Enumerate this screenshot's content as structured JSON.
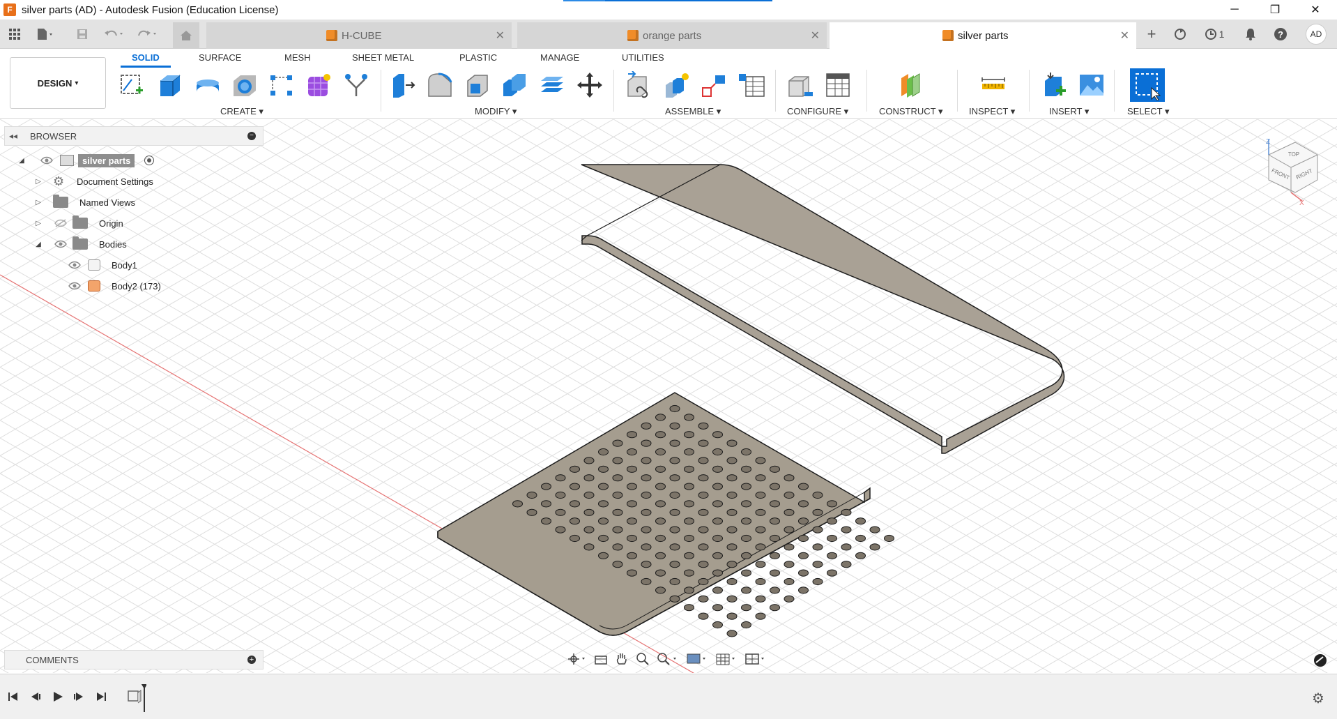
{
  "window": {
    "title": "silver parts (AD) - Autodesk Fusion (Education License)",
    "controls": {
      "minimize": "─",
      "maximize": "❐",
      "close": "✕"
    }
  },
  "tabs": [
    {
      "label": "H-CUBE",
      "close": "✕"
    },
    {
      "label": "orange parts",
      "close": "✕"
    },
    {
      "label": "silver parts",
      "close": "✕"
    }
  ],
  "toolbar_right": {
    "jobs_count": "1",
    "user_initials": "AD"
  },
  "workspace": {
    "label": "DESIGN",
    "caret": "▾"
  },
  "ribbon_tabs": [
    "SOLID",
    "SURFACE",
    "MESH",
    "SHEET METAL",
    "PLASTIC",
    "MANAGE",
    "UTILITIES"
  ],
  "ribbon_groups": {
    "create": "CREATE ▾",
    "modify": "MODIFY ▾",
    "assemble": "ASSEMBLE ▾",
    "configure": "CONFIGURE ▾",
    "construct": "CONSTRUCT ▾",
    "inspect": "INSPECT ▾",
    "insert": "INSERT ▾",
    "select": "SELECT ▾"
  },
  "browser": {
    "title": "BROWSER",
    "items": [
      {
        "label": "silver parts"
      },
      {
        "label": "Document Settings"
      },
      {
        "label": "Named Views"
      },
      {
        "label": "Origin"
      },
      {
        "label": "Bodies"
      },
      {
        "label": "Body1"
      },
      {
        "label": "Body2 (173)"
      }
    ]
  },
  "comments": {
    "title": "COMMENTS"
  },
  "viewcube": {
    "top": "TOP",
    "front": "FRONT",
    "right": "RIGHT",
    "z": "Z",
    "x": "X"
  },
  "colors": {
    "accent": "#0a6fd6",
    "part_fill": "#a59d8f",
    "part_stroke": "#1e1e1e",
    "orange_cube": "#f08c28"
  }
}
